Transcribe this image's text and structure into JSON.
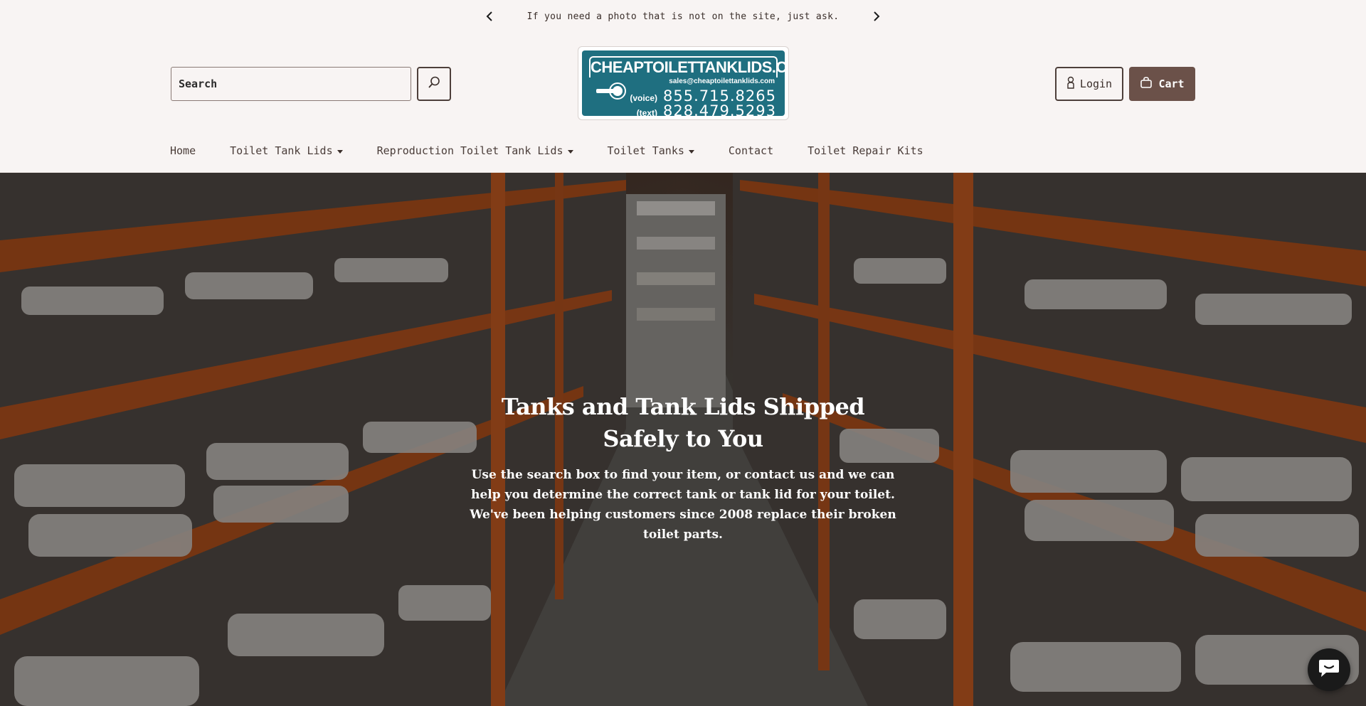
{
  "announcement": {
    "message": "If you need a photo that is not on the site, just ask.",
    "prev_icon": "chevron-left-icon",
    "next_icon": "chevron-right-icon"
  },
  "search": {
    "placeholder": "Search",
    "icon": "search-icon"
  },
  "logo": {
    "title": "CHEAPTOILETTANKLIDS.COM",
    "email": "sales@cheaptoilettanklids.com",
    "voice_label": "(voice)",
    "voice_number": "855.715.8265",
    "text_label": "(text)",
    "text_number": "828.479.5293"
  },
  "account": {
    "login_label": "Login",
    "cart_label": "Cart"
  },
  "nav": {
    "items": [
      {
        "label": "Home",
        "dropdown": false
      },
      {
        "label": "Toilet Tank Lids",
        "dropdown": true
      },
      {
        "label": "Reproduction Toilet Tank Lids",
        "dropdown": true
      },
      {
        "label": "Toilet Tanks",
        "dropdown": true
      },
      {
        "label": "Contact",
        "dropdown": false
      },
      {
        "label": "Toilet Repair Kits",
        "dropdown": false
      }
    ]
  },
  "hero": {
    "title": "Tanks and Tank Lids Shipped Safely to You",
    "text": "Use the search box to find your item, or contact us and we can help you determine the correct tank or tank lid for your toilet. We've been helping customers since 2008 replace their broken toilet parts."
  },
  "colors": {
    "background": "#f8f4f3",
    "cart_button": "#6b5149",
    "logo_teal": "#1f6f80"
  }
}
